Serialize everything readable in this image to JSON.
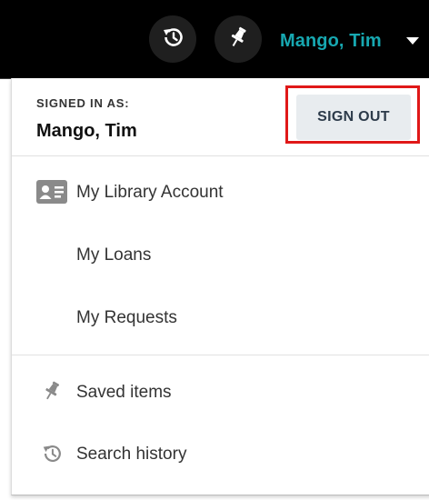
{
  "topbar": {
    "history_icon": "history-icon",
    "pin_icon": "pushpin-icon",
    "user_name": "Mango, Tim",
    "caret_icon": "caret-down-icon"
  },
  "account_menu": {
    "signed_in_label": "SIGNED IN AS:",
    "signed_in_name": "Mango, Tim",
    "sign_out_label": "SIGN OUT",
    "highlight_color": "#e01818",
    "items": [
      {
        "label": "My Library Account",
        "icon": "id-card-icon"
      },
      {
        "label": "My Loans"
      },
      {
        "label": "My Requests"
      },
      {
        "label": "Saved items",
        "icon": "pushpin-icon"
      },
      {
        "label": "Search history",
        "icon": "history-icon"
      }
    ]
  },
  "colors": {
    "topbar_bg": "#000000",
    "user_accent": "#17a8b1",
    "button_bg": "#e8ecef"
  }
}
